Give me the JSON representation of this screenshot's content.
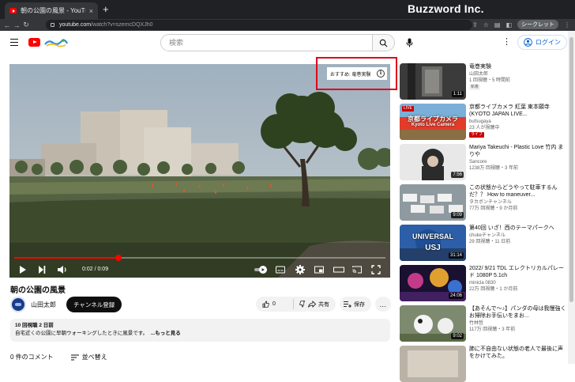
{
  "browser": {
    "tab_title": "朝の公園の風景 - YouTube",
    "tab_close": "×",
    "new_tab": "+",
    "brand_overlay": "Buzzword Inc.",
    "url_domain": "youtube.com",
    "url_path": "/watch?v=szemcDQXJh0",
    "incognito_label": "シークレット"
  },
  "header": {
    "search_placeholder": "検索",
    "login_label": "ログイン"
  },
  "player": {
    "suggestion_label": "おすすめ: 竜巻実験",
    "info_glyph": "i",
    "time": "0:02 / 0:09",
    "progress": 0.28
  },
  "video": {
    "title": "朝の公園の風景",
    "channel": "山田太郎",
    "subscribe_label": "チャンネル登録",
    "like_count": "0",
    "share_label": "共有",
    "save_label": "保存",
    "more_label": "…",
    "views_meta": "10 回視聴  2 日前",
    "description": "自宅近くの公園に早朝ウォーキングしたときに風景です。",
    "more_link": "...もっと見る"
  },
  "comments": {
    "count_label": "0 件のコメント",
    "sort_label": "並べ替え"
  },
  "sidebar": [
    {
      "title": "竜巻実験",
      "channel": "山田太郎",
      "meta": "1 回視聴・5 時間前",
      "badge": "新着",
      "duration": "1:11"
    },
    {
      "title": "京都ライブカメラ 紅葉 東本願寺 (KYOTO JAPAN LIVE...",
      "channel": "bufsugaya",
      "meta": "23 人が視聴中",
      "badge": "ライブ",
      "duration": "",
      "thumb_text": "京都ライブカメラ",
      "thumb_sub": "Kyoto Live Camera",
      "thumb_live": "LIVE"
    },
    {
      "title": "Mariya Takeuchi - Plastic Love 竹内 まりや",
      "channel": "Sancore",
      "meta": "1238万 回視聴・3 年前",
      "badge": "",
      "duration": "7:56"
    },
    {
      "title": "この状態からどうやって駐車するんだ？？ How to maneuver...",
      "channel": "タカボンチャンネル",
      "meta": "77万 回視聴・9 か月前",
      "badge": "",
      "duration": "9:09"
    },
    {
      "title": "第40回 いざ！西のテーマパークへ",
      "channel": "chukeチャンネル",
      "meta": "29 回視聴・11 日前",
      "badge": "",
      "duration": "31:14",
      "thumb_text": "UNIVERSAL",
      "thumb_sub": "USJ"
    },
    {
      "title": "2022/ 9/21 TDL エレクトリカルパレード 1080P 5.1ch",
      "channel": "minicla 0830",
      "meta": "22万 回視聴・1 か月前",
      "badge": "",
      "duration": "24:06"
    },
    {
      "title": "【あそんで〜♪】パンダの母は我慢強く お掃除お手伝いをまお...",
      "channel": "竹林哲",
      "meta": "117万 回視聴・3 年前",
      "badge": "",
      "duration": "9:02"
    },
    {
      "title": "肺に不自由ない状態の老人で最後に声をかけてみた。",
      "channel": "",
      "meta": "",
      "badge": "",
      "duration": ""
    }
  ],
  "colors": {
    "accent_red": "#ff0000",
    "highlight_box": "#e0001b",
    "link_blue": "#065fd4",
    "chrome_dark": "#202124"
  }
}
